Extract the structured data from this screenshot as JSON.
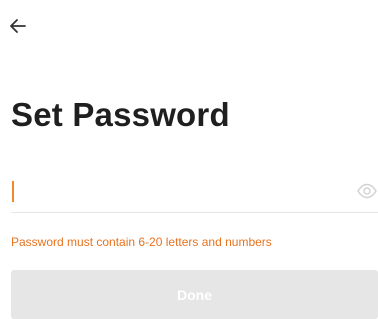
{
  "header": {
    "back_icon": "arrow-left-icon"
  },
  "page": {
    "title": "Set Password"
  },
  "password_field": {
    "value": "",
    "placeholder": "",
    "toggle_icon": "eye-icon"
  },
  "hint": {
    "text": "Password must contain 6-20 letters and numbers",
    "color": "#e8731f"
  },
  "actions": {
    "done_label": "Done",
    "done_bg": "#e6e6e6"
  },
  "colors": {
    "accent": "#f08a24"
  }
}
